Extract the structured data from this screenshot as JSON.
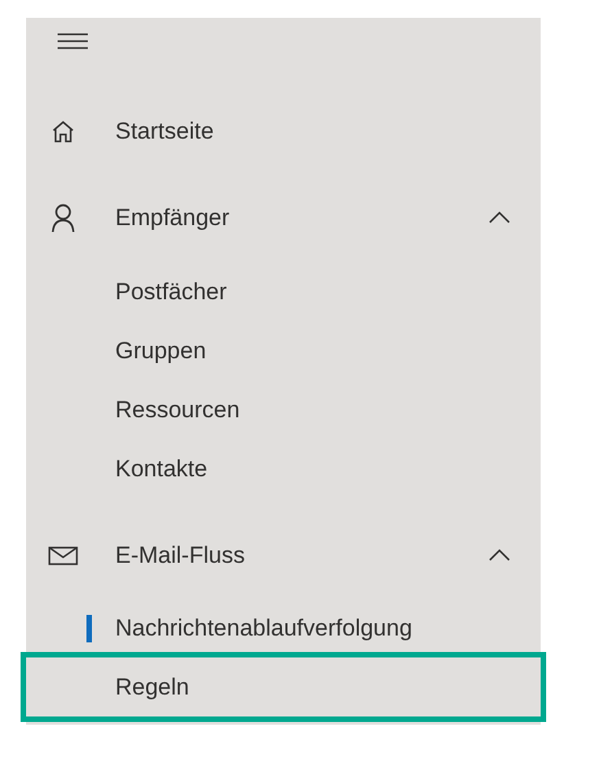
{
  "nav": {
    "sections": [
      {
        "label": "Startseite",
        "kind": "home"
      },
      {
        "label": "Empfänger",
        "kind": "person",
        "expanded": true,
        "children": [
          {
            "label": "Postfächer",
            "selected": false,
            "highlighted": false
          },
          {
            "label": "Gruppen",
            "selected": false,
            "highlighted": false
          },
          {
            "label": "Ressourcen",
            "selected": false,
            "highlighted": false
          },
          {
            "label": "Kontakte",
            "selected": false,
            "highlighted": false
          }
        ]
      },
      {
        "label": "E-Mail-Fluss",
        "kind": "mail",
        "expanded": true,
        "children": [
          {
            "label": "Nachrichtenablaufverfolgung",
            "selected": true,
            "highlighted": false
          },
          {
            "label": "Regeln",
            "selected": false,
            "highlighted": true
          }
        ]
      }
    ]
  }
}
